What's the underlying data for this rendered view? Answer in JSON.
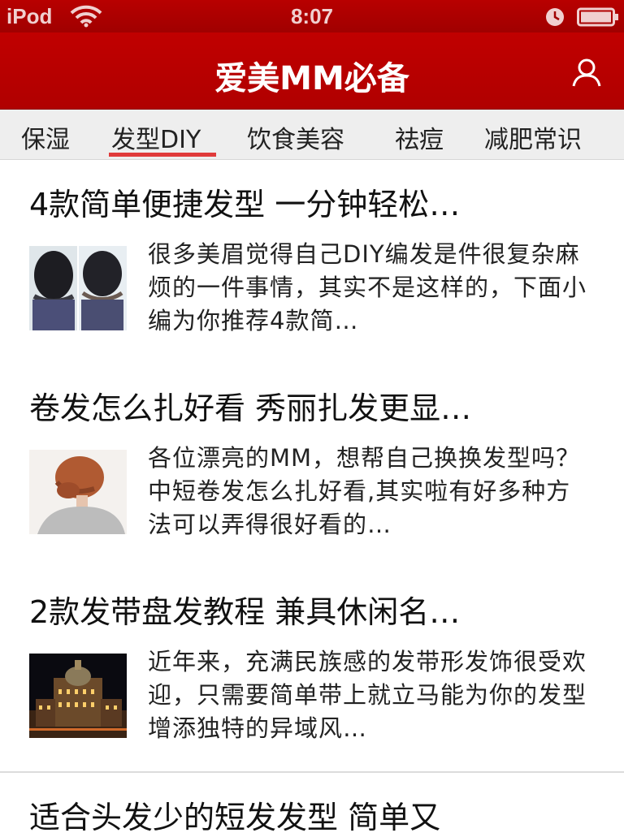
{
  "status_bar": {
    "carrier": "iPod",
    "time": "8:07",
    "icons": [
      "wifi-icon",
      "clock-icon",
      "battery-icon"
    ]
  },
  "header": {
    "title": "爱美MM必备",
    "user_icon": "user-icon"
  },
  "tabs": [
    {
      "label": "保湿",
      "active": false
    },
    {
      "label": "发型DIY",
      "active": true
    },
    {
      "label": "饮食美容",
      "active": false
    },
    {
      "label": "祛痘",
      "active": false
    },
    {
      "label": "减肥常识",
      "active": false
    }
  ],
  "colors": {
    "header_red": "#b50000",
    "tab_underline": "#e03a3a",
    "tab_bg": "#eeeeee"
  },
  "articles": [
    {
      "title": "4款简单便捷发型 一分钟轻松…",
      "summary": "很多美眉觉得自己DIY编发是件很复杂麻烦的一件事情，其实不是这样的，下面小编为你推荐4款简…"
    },
    {
      "title": "卷发怎么扎好看 秀丽扎发更显…",
      "summary": "各位漂亮的MM，想帮自己换换发型吗？中短卷发怎么扎好看,其实啦有好多种方法可以弄得很好看的…"
    },
    {
      "title": "2款发带盘发教程 兼具休闲名…",
      "summary": "近年来，充满民族感的发带形发饰很受欢迎，只需要简单带上就立马能为你的发型增添独特的异域风…"
    },
    {
      "title": "适合头发少的短发发型 简单又"
    }
  ]
}
